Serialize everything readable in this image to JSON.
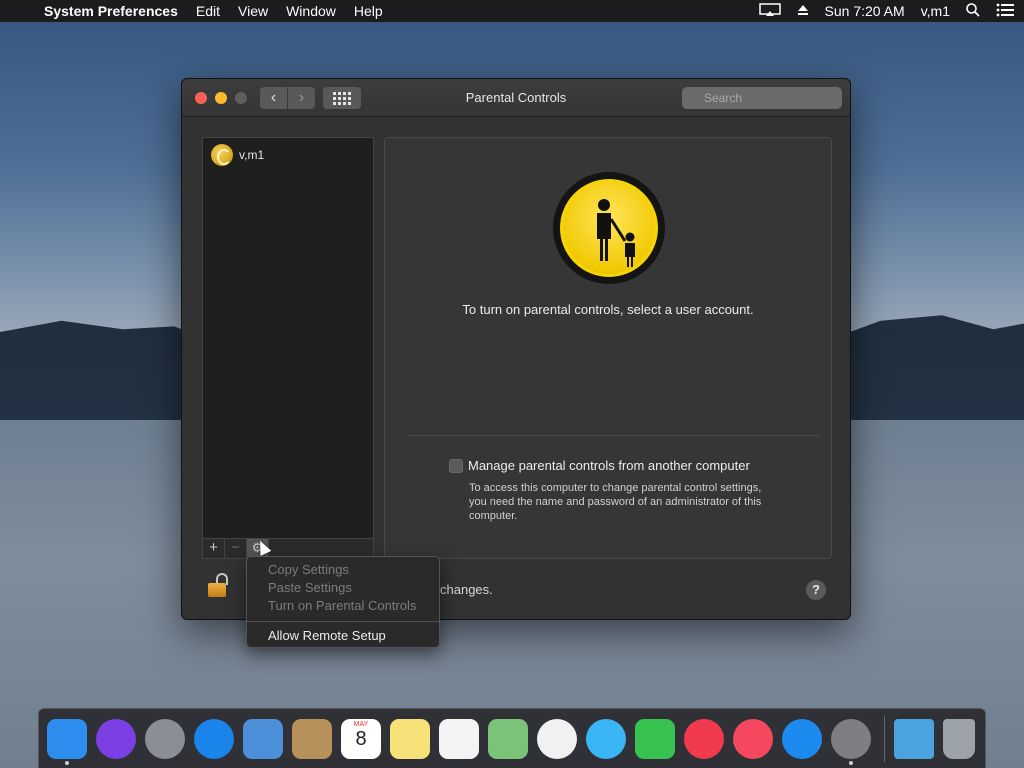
{
  "menubar": {
    "app": "System Preferences",
    "items": [
      "Edit",
      "View",
      "Window",
      "Help"
    ],
    "clock": "Sun 7:20 AM",
    "user": "v,m1"
  },
  "window": {
    "title": "Parental Controls",
    "search_placeholder": "Search"
  },
  "users": [
    {
      "name": "v,m1"
    }
  ],
  "list_buttons": {
    "add": "+",
    "remove": "−",
    "gear": "⚙"
  },
  "pane": {
    "message": "To turn on parental controls, select a user account.",
    "remote_checkbox_label": "Manage parental controls from another computer",
    "remote_note": "To access this computer to change parental control settings, you need the name and password of an administrator of this computer."
  },
  "footer": {
    "lock_text_fragment": "changes.",
    "help_label": "?"
  },
  "context_menu": {
    "items": [
      {
        "label": "Copy Settings",
        "enabled": false
      },
      {
        "label": "Paste Settings",
        "enabled": false
      },
      {
        "label": "Turn on Parental Controls",
        "enabled": false
      },
      {
        "label": "Allow Remote Setup",
        "enabled": true
      }
    ]
  },
  "dock": {
    "calendar_month": "MAY",
    "calendar_day": "8",
    "apps": [
      {
        "icon": "finder-icon",
        "color": "#2e8ef0",
        "running": true
      },
      {
        "icon": "siri-icon",
        "color": "#7b3fe4",
        "running": false
      },
      {
        "icon": "launchpad-icon",
        "color": "#8a8f96",
        "running": false
      },
      {
        "icon": "safari-icon",
        "color": "#1a84ea",
        "running": false
      },
      {
        "icon": "mail-icon",
        "color": "#4a8fd8",
        "running": false
      },
      {
        "icon": "contacts-icon",
        "color": "#b8905a",
        "running": false
      },
      {
        "icon": "calendar-icon",
        "color": "#ffffff",
        "running": false
      },
      {
        "icon": "notes-icon",
        "color": "#f7e27a",
        "running": false
      },
      {
        "icon": "reminders-icon",
        "color": "#f4f4f4",
        "running": false
      },
      {
        "icon": "maps-icon",
        "color": "#7cc37a",
        "running": false
      },
      {
        "icon": "photos-icon",
        "color": "#f1f1f1",
        "running": false
      },
      {
        "icon": "messages-icon",
        "color": "#3ab6f7",
        "running": false
      },
      {
        "icon": "facetime-icon",
        "color": "#38c24f",
        "running": false
      },
      {
        "icon": "news-icon",
        "color": "#f23a4f",
        "running": false
      },
      {
        "icon": "music-icon",
        "color": "#f5485f",
        "running": false
      },
      {
        "icon": "app-store-icon",
        "color": "#1d8af0",
        "running": false
      },
      {
        "icon": "system-preferences-icon",
        "color": "#7d7f84",
        "running": true
      }
    ],
    "folder_color": "#4aa3df",
    "trash_color": "#9da3aa"
  }
}
